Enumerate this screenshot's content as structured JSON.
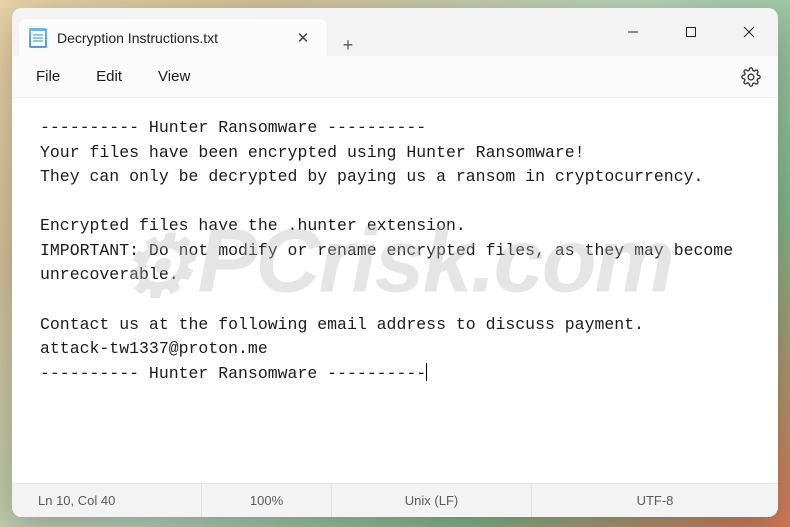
{
  "titlebar": {
    "tab_title": "Decryption Instructions.txt",
    "close_glyph": "✕",
    "newtab_glyph": "+"
  },
  "menu": {
    "file": "File",
    "edit": "Edit",
    "view": "View"
  },
  "content": {
    "text": "---------- Hunter Ransomware ----------\nYour files have been encrypted using Hunter Ransomware!\nThey can only be decrypted by paying us a ransom in cryptocurrency.\n\nEncrypted files have the .hunter extension.\nIMPORTANT: Do not modify or rename encrypted files, as they may become unrecoverable.\n\nContact us at the following email address to discuss payment.\nattack-tw1337@proton.me\n---------- Hunter Ransomware ----------"
  },
  "statusbar": {
    "position": "Ln 10, Col 40",
    "zoom": "100%",
    "eol": "Unix (LF)",
    "encoding": "UTF-8"
  },
  "watermark": {
    "text": "PCrisk.com"
  }
}
